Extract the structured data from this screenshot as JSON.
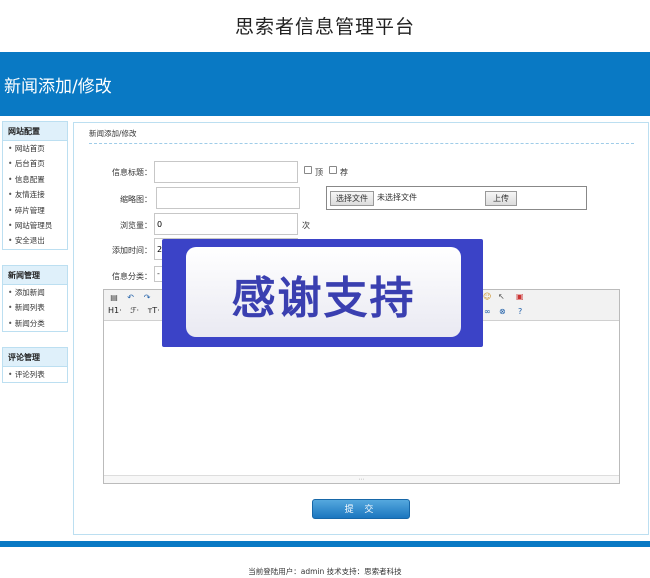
{
  "header": {
    "site_title": "思索者信息管理平台",
    "banner_title": "新闻添加/修改"
  },
  "sidebar": {
    "groups": [
      {
        "title": "网站配置",
        "items": [
          "网站首页",
          "后台首页",
          "信息配置",
          "友情连接",
          "碎片管理",
          "网站管理员",
          "安全退出"
        ]
      },
      {
        "title": "新闻管理",
        "items": [
          "添加新闻",
          "新闻列表",
          "新闻分类"
        ]
      },
      {
        "title": "评论管理",
        "items": [
          "评论列表"
        ]
      }
    ]
  },
  "main": {
    "breadcrumb": "新闻添加/修改",
    "form": {
      "title_label": "信息标题：",
      "title_value": "",
      "top_label": "顶",
      "recommend_label": "荐",
      "thumb_label": "缩略图：",
      "thumb_value": "",
      "file_button": "选择文件",
      "file_status": "未选择文件",
      "upload_button": "上传",
      "views_label": "浏览量：",
      "views_value": "0",
      "views_unit": "次",
      "time_label": "添加时间：",
      "time_value": "2",
      "category_label": "信息分类：",
      "category_value": "-"
    },
    "editor": {
      "row1": [
        "撤销",
        "重做"
      ],
      "row2": [
        "H1·",
        "ℱ·",
        "тT·"
      ],
      "content": ""
    },
    "submit_label": "提 交"
  },
  "overlay": {
    "text": "感谢支持"
  },
  "footer": {
    "text": "当前登陆用户：admin  技术支持：思索者科技"
  },
  "colors": {
    "brand_blue": "#0979c4",
    "sidebar_head_bg": "#dff0fa",
    "overlay_bg": "#3b43c7"
  },
  "icons": [
    "source-icon",
    "undo-icon",
    "redo-icon",
    "emotion-icon",
    "cursor-icon",
    "preview-icon",
    "link-icon",
    "unlink-icon",
    "help-icon"
  ]
}
